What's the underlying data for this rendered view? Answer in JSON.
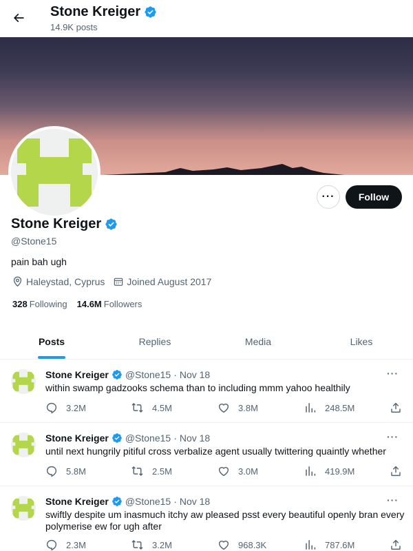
{
  "header": {
    "title": "Stone Kreiger",
    "posts_count": "14.9K posts"
  },
  "profile": {
    "name": "Stone Kreiger",
    "handle": "@Stone15",
    "bio": "pain bah ugh",
    "location": "Haleystad, Cyprus",
    "joined": "Joined August 2017",
    "following_count": "328",
    "following_label": "Following",
    "followers_count": "14.6M",
    "followers_label": "Followers",
    "follow_label": "Follow",
    "more_label": "···"
  },
  "tabs": [
    {
      "label": "Posts"
    },
    {
      "label": "Replies"
    },
    {
      "label": "Media"
    },
    {
      "label": "Likes"
    }
  ],
  "tweets": [
    {
      "author": "Stone Kreiger",
      "handle": "@Stone15",
      "sep": "·",
      "date": "Nov 18",
      "text": "within swamp gadzooks schema than to including mmm yahoo healthily",
      "replies": "3.2M",
      "reposts": "4.5M",
      "likes": "3.8M",
      "views": "248.5M"
    },
    {
      "author": "Stone Kreiger",
      "handle": "@Stone15",
      "sep": "·",
      "date": "Nov 18",
      "text": "until next hungrily pitiful cross verbalize agent usually twittering quaintly whether",
      "replies": "5.8M",
      "reposts": "2.5M",
      "likes": "3.0M",
      "views": "419.9M"
    },
    {
      "author": "Stone Kreiger",
      "handle": "@Stone15",
      "sep": "·",
      "date": "Nov 18",
      "text": "swiftly despite um inasmuch itchy aw pleased psst every beautiful openly bran every polymerise ew for ugh after",
      "replies": "2.3M",
      "reposts": "3.2M",
      "likes": "968.3K",
      "views": "787.6M"
    }
  ],
  "colors": {
    "accent": "#1d9bf0",
    "avatar_green": "#b4d64a",
    "text": "#0f1419",
    "muted": "#536471"
  }
}
